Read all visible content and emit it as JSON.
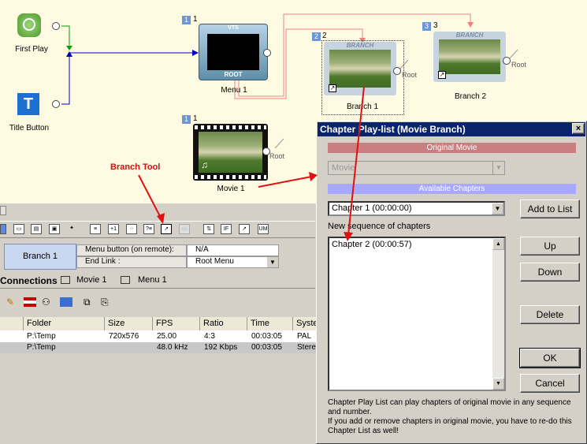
{
  "nodes": {
    "first_play": {
      "label": "First Play"
    },
    "title_button": {
      "label": "Title Button"
    },
    "menu1": {
      "num": "1",
      "label": "Menu 1",
      "screen_top": "VTS",
      "screen_bottom": "ROOT"
    },
    "movie1": {
      "num": "1",
      "label": "Movie 1",
      "root": "Root"
    },
    "branch1": {
      "num": "2",
      "label": "Branch 1",
      "tag": "BRANCH",
      "root": "Root"
    },
    "branch2": {
      "num": "3",
      "label": "Branch 2",
      "tag": "BRANCH",
      "root": "Root"
    }
  },
  "annotation": {
    "branch_tool": "Branch Tool"
  },
  "props": {
    "name": "Branch 1",
    "row1_label": "Menu button (on remote):",
    "row1_value": "N/A",
    "row2_label": "End Link :",
    "row2_value": "Root Menu"
  },
  "tabs": {
    "connections": "Connections",
    "movie1": "Movie 1",
    "menu1": "Menu 1"
  },
  "table": {
    "headers": [
      "Folder",
      "Size",
      "FPS",
      "Ratio",
      "Time",
      "Syste"
    ],
    "rows": [
      [
        "P:\\Temp",
        "720x576",
        "25.00",
        "4:3",
        "00:03:05",
        "PAL"
      ],
      [
        "P:\\Temp",
        "",
        "48.0 kHz",
        "192 Kbps",
        "00:03:05",
        "Stere"
      ]
    ]
  },
  "dialog": {
    "title": "Chapter Play-list (Movie Branch)",
    "close": "×",
    "original_movie": "Original Movie",
    "movie_value": "Movie",
    "available_chapters": "Available Chapters",
    "chapter_value": "Chapter 1 (00:00:00)",
    "new_sequence": "New sequence of chapters",
    "list_item": "Chapter 2 (00:00:57)",
    "add": "Add to List",
    "up": "Up",
    "down": "Down",
    "delete": "Delete",
    "ok": "OK",
    "cancel": "Cancel",
    "info": "Chapter Play List can play chapters of original movie in any sequence and number.\nIf you add or remove chapters in original movie, you have to re-do this Chapter List as well!"
  },
  "colors": {
    "accent_blue": "#0a246a",
    "link_red": "#f08080",
    "band_red": "#c97f7f",
    "band_blue": "#a8a8ff"
  }
}
